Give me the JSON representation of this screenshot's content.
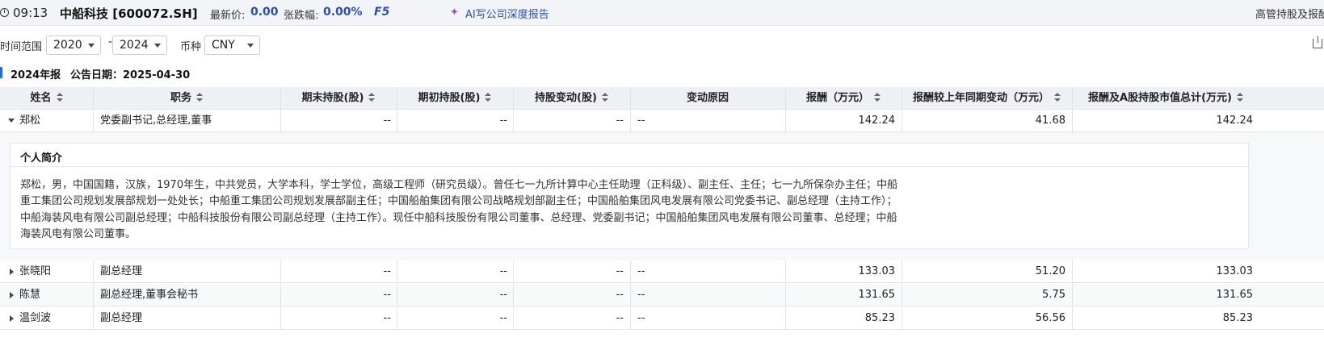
{
  "topbar": {
    "time": "09:13",
    "stock": "中船科技 [600072.SH]",
    "price_label": "最新价:",
    "price_value": "0.00",
    "change_label": "张跌幅:",
    "change_value": "0.00%",
    "refresh_key": "F5",
    "ai_link": "AI写公司深度报告",
    "right_title": "高管持股及报酬"
  },
  "filters": {
    "range_label": "时间范围",
    "year_from": "2020",
    "dash": "-",
    "year_to": "2024",
    "currency_label": "币种",
    "currency": "CNY"
  },
  "report": {
    "title": "2024年报",
    "date_label": "公告日期：2025-04-30"
  },
  "table": {
    "columns": [
      "姓名",
      "职务",
      "期末持股(股)",
      "期初持股(股)",
      "持股变动(股)",
      "变动原因",
      "报酬（万元）",
      "报酬较上年同期变动（万元）",
      "报酬及A股持股市值总计(万元)"
    ],
    "rows": [
      {
        "name": "郑松",
        "position": "党委副书记,总经理,董事",
        "end_shares": "--",
        "start_shares": "--",
        "change_shares": "--",
        "reason": "--",
        "pay": "142.24",
        "pay_change": "41.68",
        "total": "142.24"
      },
      {
        "name": "张晓阳",
        "position": "副总经理",
        "end_shares": "--",
        "start_shares": "--",
        "change_shares": "--",
        "reason": "--",
        "pay": "133.03",
        "pay_change": "51.20",
        "total": "133.03"
      },
      {
        "name": "陈慧",
        "position": "副总经理,董事会秘书",
        "end_shares": "--",
        "start_shares": "--",
        "change_shares": "--",
        "reason": "--",
        "pay": "131.65",
        "pay_change": "5.75",
        "total": "131.65"
      },
      {
        "name": "温剑波",
        "position": "副总经理",
        "end_shares": "--",
        "start_shares": "--",
        "change_shares": "--",
        "reason": "--",
        "pay": "85.23",
        "pay_change": "56.56",
        "total": "85.23"
      }
    ]
  },
  "profile": {
    "title": "个人简介",
    "text": "郑松，男，中国国籍，汉族，1970年生，中共党员，大学本科，学士学位，高级工程师（研究员级）。曾任七一九所计算中心主任助理（正科级）、副主任、主任；七一九所保杂办主任；中船重工集团公司规划发展部规划一处处长；中船重工集团公司规划发展部副主任；中国船舶集团有限公司战略规划部副主任；中国船舶集团风电发展有限公司党委书记、副总经理（主持工作）；中船海装风电有限公司副总经理；中船科技股份有限公司副总经理（主持工作）。现任中船科技股份有限公司董事、总经理、党委副书记；中国船舶集团风电发展有限公司董事、总经理；中船海装风电有限公司董事。"
  }
}
